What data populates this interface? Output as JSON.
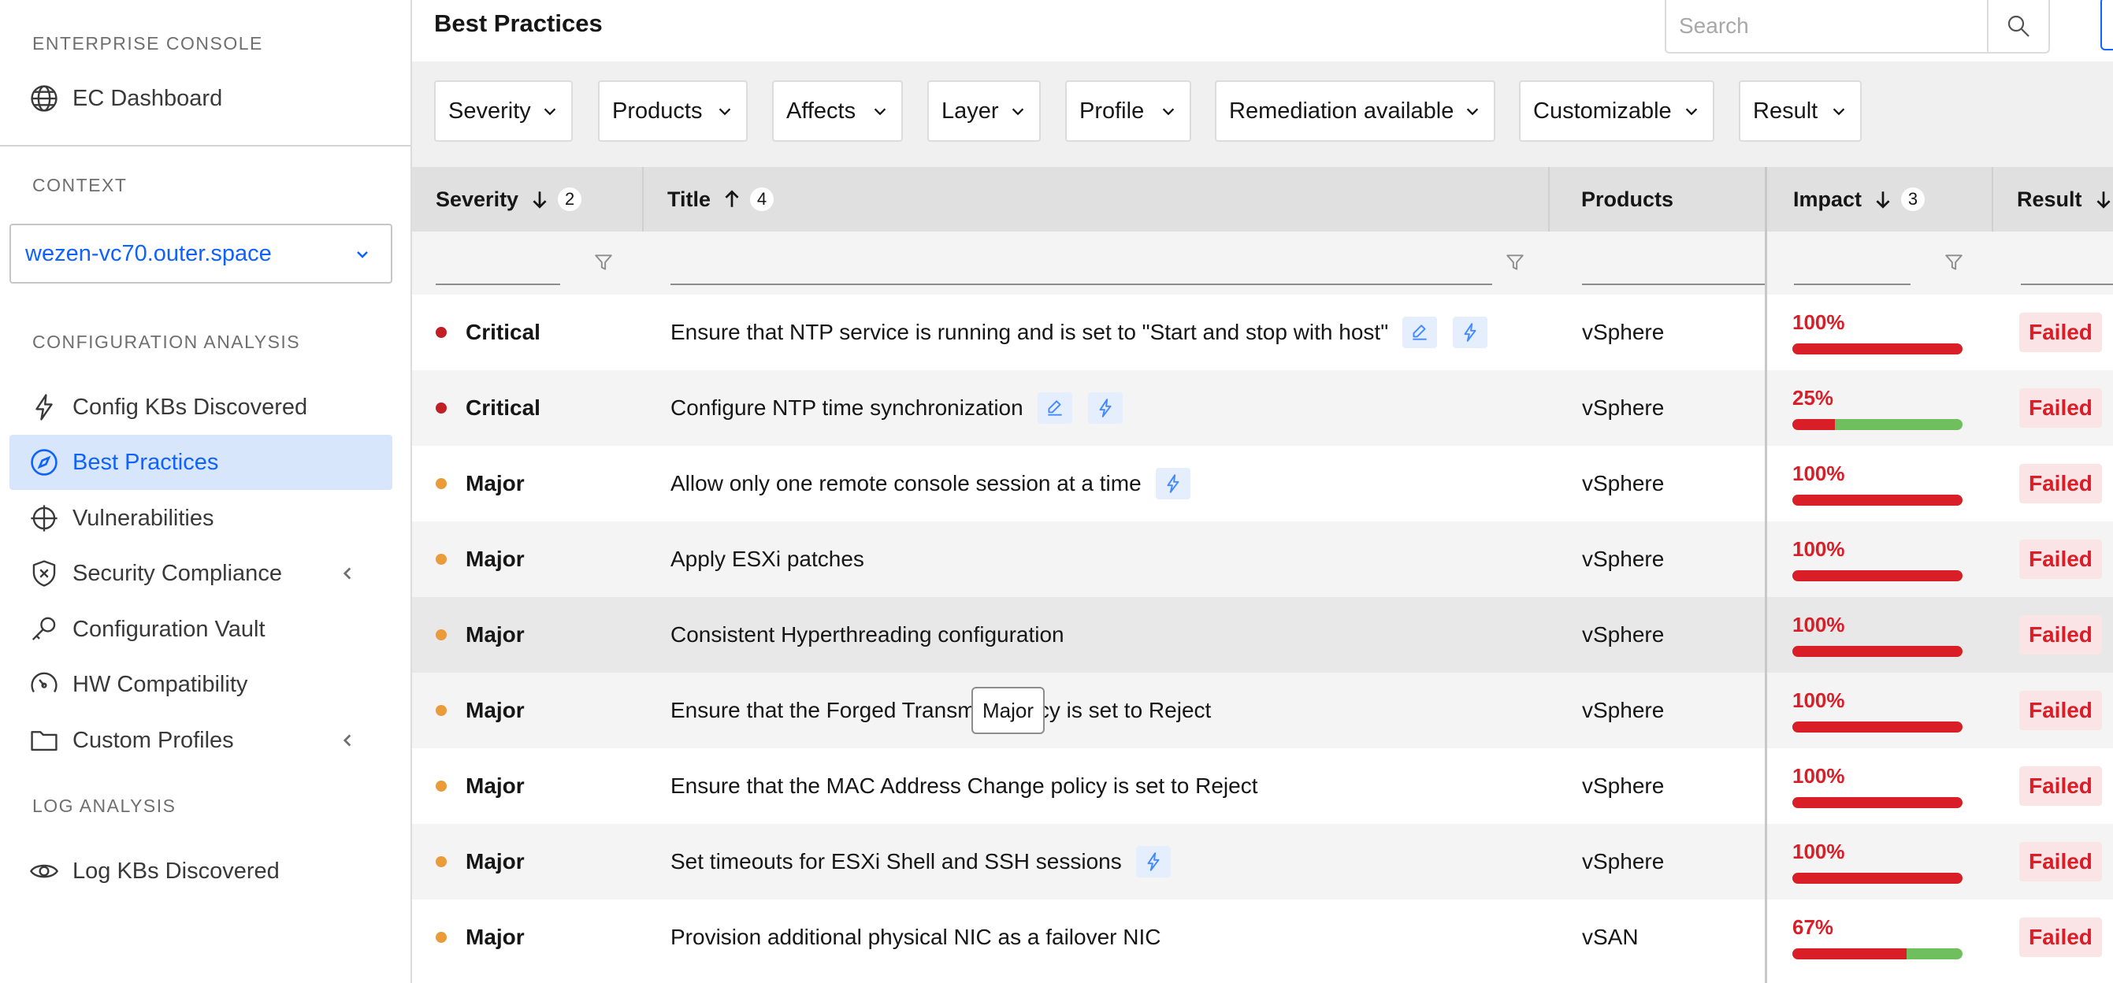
{
  "sidebar": {
    "enterprise_label": "ENTERPRISE CONSOLE",
    "ec_dashboard": "EC Dashboard",
    "context_label": "CONTEXT",
    "context_value": "wezen-vc70.outer.space",
    "config_analysis_label": "CONFIGURATION ANALYSIS",
    "items": [
      {
        "label": "Config KBs Discovered",
        "icon": "lightning-icon"
      },
      {
        "label": "Best Practices",
        "icon": "compass-icon",
        "active": true
      },
      {
        "label": "Vulnerabilities",
        "icon": "crosshair-icon"
      },
      {
        "label": "Security Compliance",
        "icon": "shield-icon",
        "expandable": true
      },
      {
        "label": "Configuration Vault",
        "icon": "key-icon"
      },
      {
        "label": "HW Compatibility",
        "icon": "gauge-icon"
      },
      {
        "label": "Custom Profiles",
        "icon": "folder-icon",
        "expandable": true
      }
    ],
    "log_analysis_label": "LOG ANALYSIS",
    "log_kbs": "Log KBs Discovered"
  },
  "header": {
    "title": "Best Practices",
    "search_placeholder": "Search"
  },
  "filters": [
    "Severity",
    "Products",
    "Affects",
    "Layer",
    "Profile",
    "Remediation available",
    "Customizable",
    "Result"
  ],
  "table": {
    "columns": {
      "severity": {
        "label": "Severity",
        "sort": "desc",
        "rank": "2"
      },
      "title": {
        "label": "Title",
        "sort": "asc",
        "rank": "4"
      },
      "products": {
        "label": "Products"
      },
      "impact": {
        "label": "Impact",
        "sort": "desc",
        "rank": "3"
      },
      "result": {
        "label": "Result"
      }
    },
    "rows": [
      {
        "severity": "Critical",
        "title": "Ensure that NTP service is running and is set to \"Start and stop with host\"",
        "tags": [
          "edit",
          "remediate"
        ],
        "product": "vSphere",
        "impact_label": "100%",
        "impact": 1.0,
        "result": "Failed"
      },
      {
        "severity": "Critical",
        "title": "Configure NTP time synchronization",
        "tags": [
          "edit",
          "remediate"
        ],
        "product": "vSphere",
        "impact_label": "25%",
        "impact": 0.25,
        "result": "Failed"
      },
      {
        "severity": "Major",
        "title": "Allow only one remote console session at a time",
        "tags": [
          "remediate"
        ],
        "product": "vSphere",
        "impact_label": "100%",
        "impact": 1.0,
        "result": "Failed"
      },
      {
        "severity": "Major",
        "title": "Apply ESXi patches",
        "tags": [],
        "product": "vSphere",
        "impact_label": "100%",
        "impact": 1.0,
        "result": "Failed"
      },
      {
        "severity": "Major",
        "title": "Consistent Hyperthreading configuration",
        "tags": [],
        "product": "vSphere",
        "impact_label": "100%",
        "impact": 1.0,
        "result": "Failed"
      },
      {
        "severity": "Major",
        "title": "Ensure that the Forged Transmits policy is set to Reject",
        "tags": [],
        "product": "vSphere",
        "impact_label": "100%",
        "impact": 1.0,
        "result": "Failed"
      },
      {
        "severity": "Major",
        "title": "Ensure that the MAC Address Change policy is set to Reject",
        "tags": [],
        "product": "vSphere",
        "impact_label": "100%",
        "impact": 1.0,
        "result": "Failed"
      },
      {
        "severity": "Major",
        "title": "Set timeouts for ESXi Shell and SSH sessions",
        "tags": [
          "remediate"
        ],
        "product": "vSphere",
        "impact_label": "100%",
        "impact": 1.0,
        "result": "Failed"
      },
      {
        "severity": "Major",
        "title": "Provision additional physical NIC as a failover NIC",
        "tags": [],
        "product": "vSAN",
        "impact_label": "67%",
        "impact": 0.67,
        "result": "Failed"
      }
    ]
  },
  "tooltip": "Major",
  "colors": {
    "accent": "#0f62fe",
    "critical": "#c21e25",
    "major": "#ea9b3a",
    "failed": "#da1e28",
    "pass_bar": "#6fbf5e"
  }
}
